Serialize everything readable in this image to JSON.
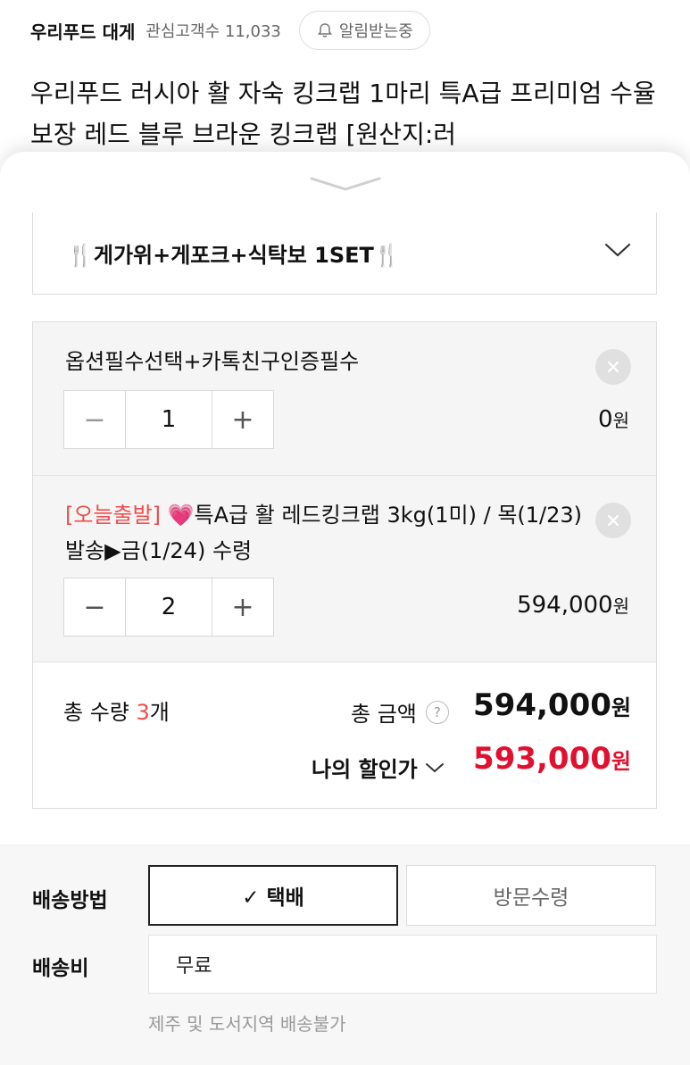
{
  "header": {
    "store_name": "우리푸드 대게",
    "followers_label": "관심고객수 11,033",
    "notify_label": "알림받는중",
    "product_title": "우리푸드 러시아 활 자숙 킹크랩 1마리 특A급 프리미엄 수율보장 레드 블루 브라운 킹크랩 [원산지:러"
  },
  "gift_option": {
    "label": "🍴게가위+게포크+식탁보 1SET🍴"
  },
  "options": [
    {
      "tag": "",
      "title": "옵션필수선택+카톡친구인증필수",
      "quantity": "1",
      "price": "0",
      "currency": "원"
    },
    {
      "tag": "[오늘출발]",
      "title": " 💗특A급 활 레드킹크랩 3kg(1미) / 목(1/23) 발송▶금(1/24) 수령",
      "quantity": "2",
      "price": "594,000",
      "currency": "원"
    }
  ],
  "stepper": {
    "minus": "−",
    "plus": "+"
  },
  "totals": {
    "qty_label": "총 수량 ",
    "qty_value": "3",
    "qty_unit": "개",
    "amount_label": "총 금액",
    "help_symbol": "?",
    "amount_value": "594,000",
    "amount_unit": "원",
    "discount_label": "나의 할인가",
    "discount_value": "593,000",
    "discount_unit": "원"
  },
  "delivery": {
    "method_label": "배송방법",
    "methods": [
      {
        "label": "✓ 택배",
        "selected": true
      },
      {
        "label": "방문수령",
        "selected": false
      }
    ],
    "fee_label": "배송비",
    "fee_value": "무료",
    "note": "제주 및 도서지역 배송불가"
  },
  "colors": {
    "accent_red": "#e0102f",
    "tag_red": "#f04c4c"
  }
}
